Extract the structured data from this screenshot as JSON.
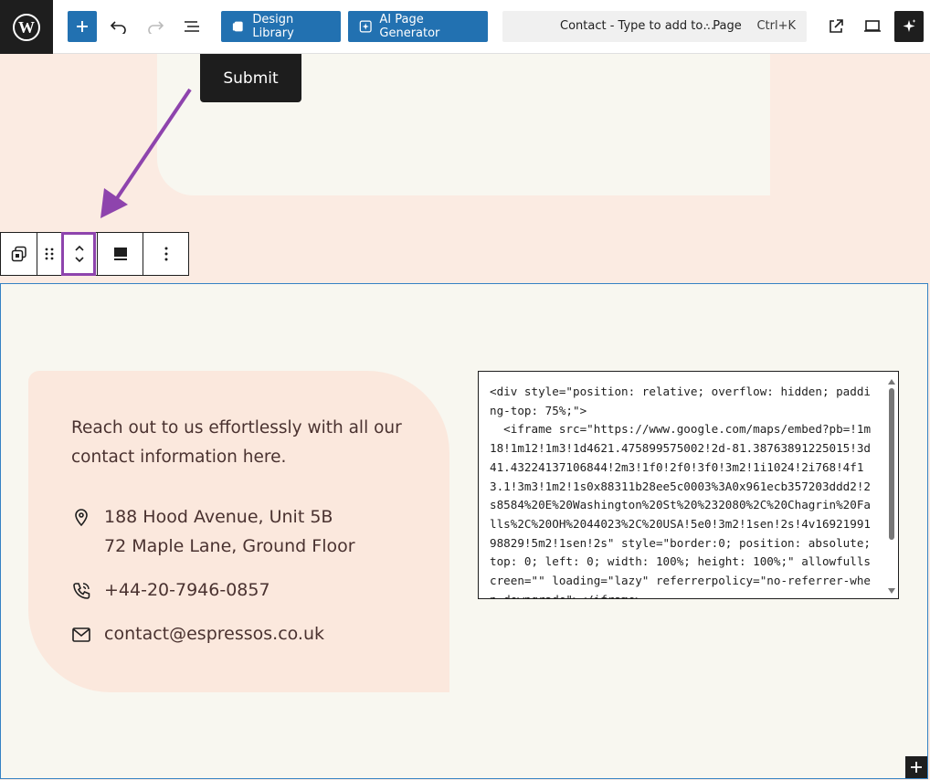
{
  "toolbar": {
    "design_library_label": "Design Library",
    "ai_generator_label": "AI Page Generator",
    "command": {
      "title": "Contact - Type to add to…",
      "type": "· Page",
      "shortcut": "Ctrl+K"
    }
  },
  "form": {
    "submit_label": "Submit"
  },
  "contact": {
    "intro": "Reach out to us effortlessly with all our contact information here.",
    "address_line1": "188 Hood Avenue, Unit 5B",
    "address_line2": "72 Maple Lane, Ground Floor",
    "phone": "+44-20-7946-0857",
    "email": "contact@espressos.co.uk"
  },
  "embed_code": "<div style=\"position: relative; overflow: hidden; padding-top: 75%;\">\n  <iframe src=\"https://www.google.com/maps/embed?pb=!1m18!1m12!1m3!1d4621.475899575002!2d-81.38763891225015!3d41.43224137106844!2m3!1f0!2f0!3f0!3m2!1i1024!2i768!4f13.1!3m3!1m2!1s0x88311b28ee5c0003%3A0x961ecb357203ddd2!2s8584%20E%20Washington%20St%20%232080%2C%20Chagrin%20Falls%2C%20OH%2044023%2C%20USA!5e0!3m2!1sen!2s!4v1692199198829!5m2!1sen!2s\" style=\"border:0; position: absolute; top: 0; left: 0; width: 100%; height: 100%;\" allowfullscreen=\"\" loading=\"lazy\" referrerpolicy=\"no-referrer-when-downgrade\"></iframe>",
  "colors": {
    "accent": "#2271b1",
    "annotation": "#8e44ad",
    "section_border": "#3582c4"
  }
}
